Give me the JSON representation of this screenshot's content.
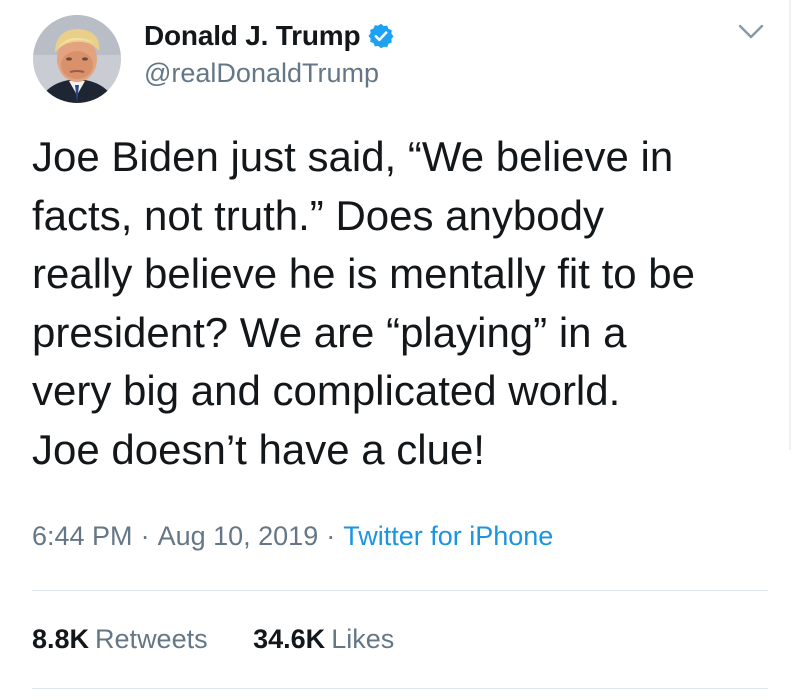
{
  "author": {
    "display_name": "Donald J. Trump",
    "handle": "@realDonaldTrump",
    "verified": true,
    "avatar_icon": "profile-photo"
  },
  "tweet": {
    "text_lines": [
      "Joe Biden just said, “We believe in",
      "facts, not truth.” Does anybody",
      "really believe he is mentally fit to be",
      "president? We are “playing” in a",
      "very big and complicated world.",
      "Joe doesn’t have a clue!"
    ]
  },
  "meta": {
    "time": "6:44 PM",
    "separator": "·",
    "date": "Aug 10, 2019",
    "source": "Twitter for iPhone"
  },
  "stats": {
    "retweets_count": "8.8K",
    "retweets_label": "Retweets",
    "likes_count": "34.6K",
    "likes_label": "Likes"
  },
  "colors": {
    "text": "#14171a",
    "secondary": "#657786",
    "link": "#1b95e0",
    "verified_badge": "#1da1f2",
    "divider": "#e1e8ed"
  },
  "icons": {
    "verified": "verified-badge-icon",
    "menu": "chevron-down-icon"
  }
}
